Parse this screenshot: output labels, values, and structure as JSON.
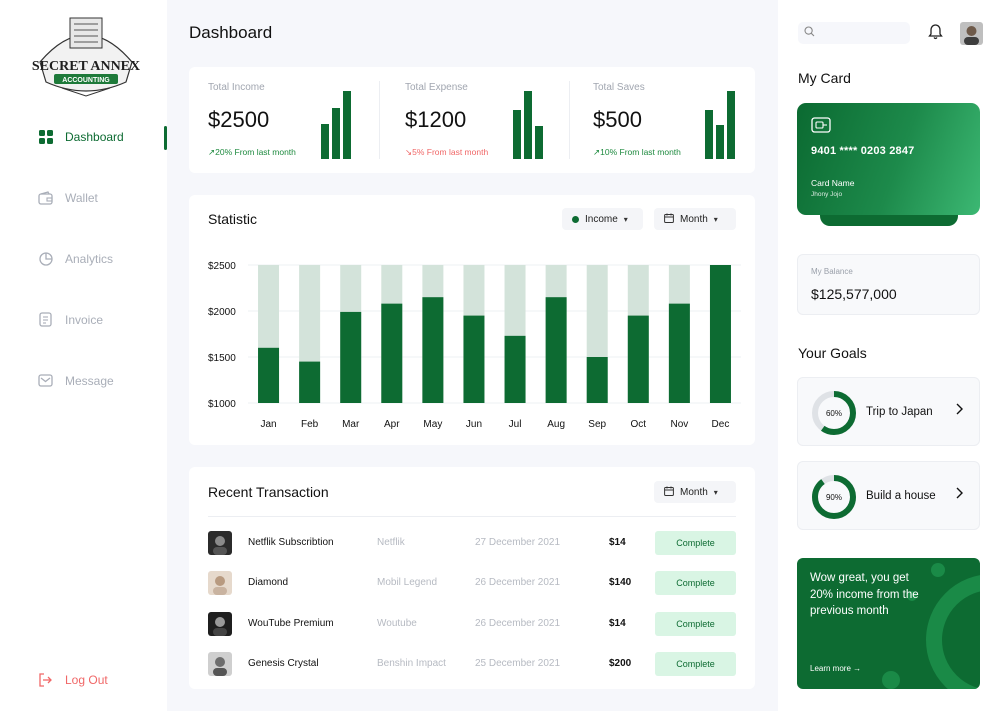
{
  "brand": {
    "line1": "SECRET ANNEX",
    "line2": "ACCOUNTING"
  },
  "sidebar": {
    "items": [
      {
        "label": "Dashboard",
        "icon": "grid-icon",
        "active": true
      },
      {
        "label": "Wallet",
        "icon": "wallet-icon"
      },
      {
        "label": "Analytics",
        "icon": "pie-chart-icon"
      },
      {
        "label": "Invoice",
        "icon": "invoice-icon"
      },
      {
        "label": "Message",
        "icon": "mail-icon"
      }
    ],
    "logout": "Log Out"
  },
  "header": {
    "title": "Dashboard"
  },
  "summary": [
    {
      "label": "Total Income",
      "value": "$2500",
      "trend": "↗20% From last month",
      "direction": "up",
      "bars": [
        0.52,
        0.75,
        1.0
      ]
    },
    {
      "label": "Total Expense",
      "value": "$1200",
      "trend": "↘5% From last month",
      "direction": "down",
      "bars": [
        0.72,
        1.0,
        0.48
      ]
    },
    {
      "label": "Total Saves",
      "value": "$500",
      "trend": "↗10% From last month",
      "direction": "up",
      "bars": [
        0.72,
        0.5,
        1.0
      ]
    }
  ],
  "statistic": {
    "title": "Statistic",
    "filter_label": "Income",
    "period_label": "Month"
  },
  "chart_data": {
    "type": "bar",
    "categories": [
      "Jan",
      "Feb",
      "Mar",
      "Apr",
      "May",
      "Jun",
      "Jul",
      "Aug",
      "Sep",
      "Oct",
      "Nov",
      "Dec"
    ],
    "values": [
      1600,
      1450,
      1990,
      2080,
      2150,
      1950,
      1730,
      2150,
      1500,
      1950,
      2080,
      2500
    ],
    "max": 2500,
    "ylim": [
      1000,
      2500
    ],
    "yticks": [
      "$2500",
      "$2000",
      "$1500",
      "$1000"
    ],
    "colors": {
      "value": "#0d6b32",
      "background": "#d3e3da"
    }
  },
  "transactions": {
    "title": "Recent Transaction",
    "period_label": "Month",
    "rows": [
      {
        "name": "Netflik Subscribtion",
        "source": "Netflik",
        "date": "27 December 2021",
        "amount": "$14",
        "status": "Complete"
      },
      {
        "name": "Diamond",
        "source": "Mobil Legend",
        "date": "26 December 2021",
        "amount": "$140",
        "status": "Complete"
      },
      {
        "name": "WouTube Premium",
        "source": "Woutube",
        "date": "26 December 2021",
        "amount": "$14",
        "status": "Complete"
      },
      {
        "name": "Genesis Crystal",
        "source": "Benshin Impact",
        "date": "25 December 2021",
        "amount": "$200",
        "status": "Complete"
      }
    ]
  },
  "right": {
    "search_placeholder": "",
    "my_card_title": "My Card",
    "card": {
      "number": "9401 **** 0203 2847",
      "name_label": "Card Name",
      "holder": "Jhony Jojo"
    },
    "balance": {
      "label": "My Balance",
      "value": "$125,577,000"
    },
    "goals_title": "Your Goals",
    "goals": [
      {
        "percent_label": "60%",
        "label": "Trip to Japan",
        "progress": 0.6
      },
      {
        "percent_label": "90%",
        "label": "Build a house",
        "progress": 0.9
      }
    ],
    "promo": {
      "text": "Wow great, you get 20% income from the previous month",
      "link": "Learn more →"
    }
  },
  "colors": {
    "brand_green": "#0d6b32",
    "danger": "#f06767",
    "muted": "#a9aeb8"
  }
}
